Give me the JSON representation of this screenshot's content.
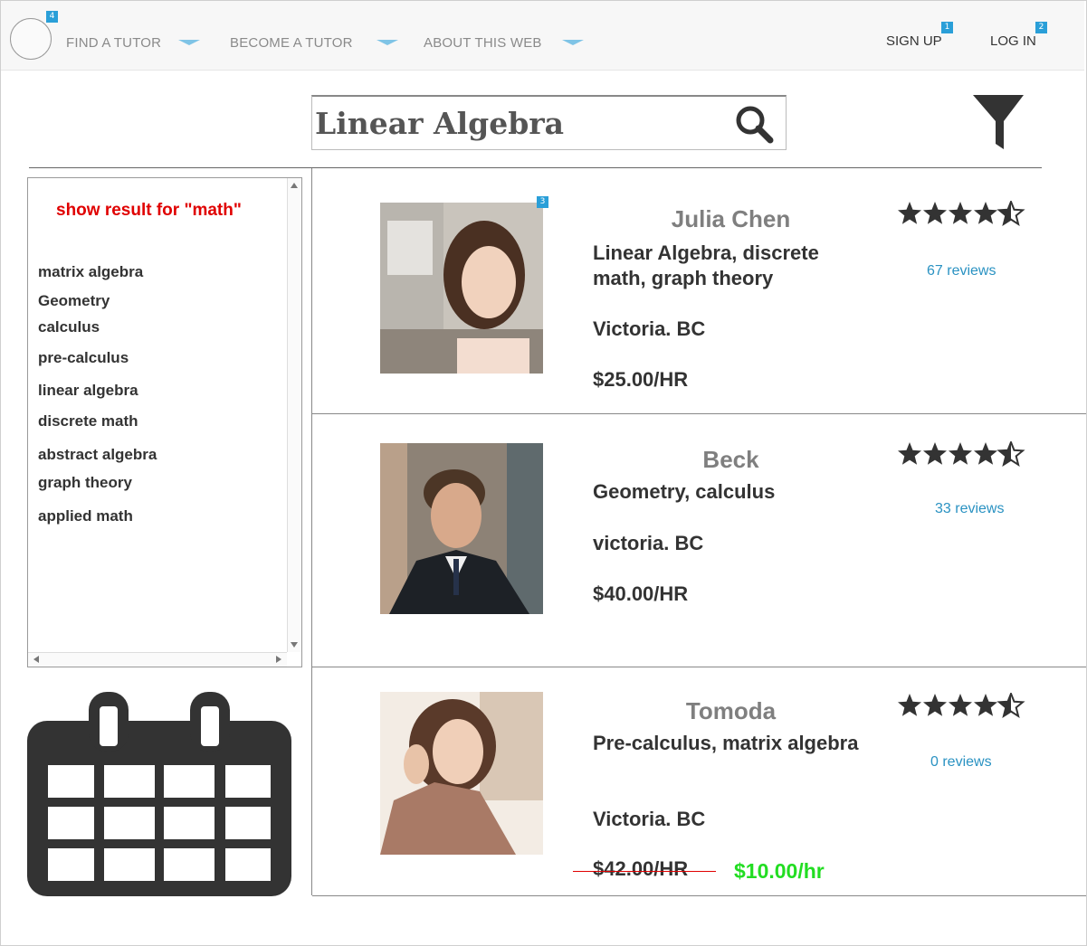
{
  "nav": {
    "badge_logo": "4",
    "find_tutor": "FIND A TUTOR",
    "become_tutor": "BECOME A TUTOR",
    "about": "ABOUT THIS WEB",
    "sign_up": "SIGN UP",
    "sign_up_badge": "1",
    "log_in": "LOG IN",
    "log_in_badge": "2"
  },
  "search": {
    "value": "Linear Algebra"
  },
  "sidebar": {
    "result_title": "show result for \"math\"",
    "subjects": [
      "matrix algebra",
      "Geometry",
      "calculus",
      "pre-calculus",
      "linear algebra",
      "discrete math",
      "abstract algebra",
      "graph theory",
      "applied math"
    ]
  },
  "tutors": [
    {
      "name": "Julia Chen",
      "subjects": "Linear Algebra, discrete math, graph theory",
      "location": "Victoria. BC",
      "rate": "$25.00/HR",
      "rating": 4.5,
      "reviews": "67 reviews",
      "badge": "3"
    },
    {
      "name": "Beck",
      "subjects": "Geometry, calculus",
      "location": "victoria. BC",
      "rate": "$40.00/HR",
      "rating": 4.5,
      "reviews": "33 reviews"
    },
    {
      "name": "Tomoda",
      "subjects": "Pre-calculus, matrix algebra",
      "location": "Victoria. BC",
      "rate": "$42.00/HR",
      "sale_rate": "$10.00/hr",
      "rating": 4.5,
      "reviews": "0 reviews"
    }
  ],
  "colors": {
    "accent": "#2a9fd8",
    "alert": "#e00000",
    "sale": "#22dd22",
    "link": "#2a92c2"
  },
  "icons": [
    "search-icon",
    "filter-icon",
    "calendar-icon",
    "star-icon"
  ]
}
